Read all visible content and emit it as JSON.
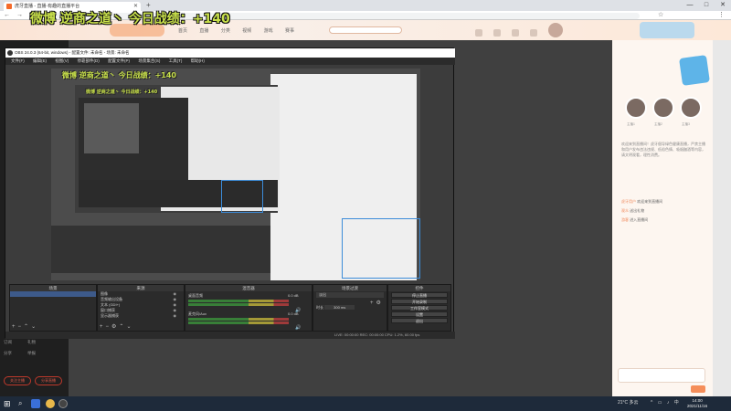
{
  "browser": {
    "tab_title": "虎牙直播 - 直播·有趣的直播平台",
    "new_tab": "+",
    "url": "www.huya.com",
    "window_controls": [
      "—",
      "□",
      "✕"
    ]
  },
  "overlay": {
    "title": "微博 逆商之道丶 今日战绩：+140",
    "title_small": "微博 逆商之道丶 今日战绩：+140"
  },
  "site": {
    "nav": [
      "首页",
      "直播",
      "分类",
      "视频",
      "游戏",
      "赛事"
    ]
  },
  "left_panel": {
    "labels": [
      "订阅",
      "礼物",
      "分享",
      "举报"
    ],
    "buttons": [
      "关注主播",
      "分享直播"
    ]
  },
  "obs": {
    "title": "OBS 24.0.3 (64-bit, windows) - 配置文件: 未命名 - 场景: 未命名",
    "menu": [
      "文件(F)",
      "编辑(E)",
      "视图(V)",
      "停靠部件(D)",
      "配置文件(P)",
      "场景集合(S)",
      "工具(T)",
      "帮助(H)"
    ],
    "scenes_header": "场景",
    "sources_header": "来源",
    "mixer_header": "混音器",
    "transitions_header": "场景过渡",
    "controls_header": "控件",
    "sources": [
      "图像",
      "音频输出设备",
      "文本 (GDI+)",
      "窗口捕获",
      "显示器捕获"
    ],
    "mixer_tracks": [
      {
        "name": "桌面音频",
        "level": "0.0 dB"
      },
      {
        "name": "麦克风/Aux",
        "level": "0.0 dB"
      }
    ],
    "transition_value": "淡出",
    "duration_label": "时长",
    "duration_value": "300 ms",
    "controls": [
      "停止直播",
      "开始录制",
      "工作室模式",
      "设置",
      "退出"
    ],
    "status": "LIVE: 00:00:00   REC: 00:00:00   CPU: 1.2%, 60.00 fps"
  },
  "right_panel": {
    "streamers": [
      "主播1",
      "主播2",
      "主播3"
    ],
    "notice": "欢迎来到直播间！虎牙倡导绿色健康直播，严禁主播和用户发布违法违规、低俗色情、吸烟酗酒等内容，请文明观看，理性消费。",
    "chat": [
      {
        "user": "虎牙用户",
        "text": "欢迎来到直播间"
      },
      {
        "user": "观众",
        "text": "送出礼物"
      },
      {
        "user": "游客",
        "text": "进入直播间"
      }
    ]
  },
  "taskbar": {
    "weather": "21°C 多云",
    "time": "14:00",
    "date": "2021/11/16"
  },
  "colors": {
    "accent": "#f58e5a",
    "overlay_text": "#c8e04a",
    "obs_bg": "#2b2b2b"
  }
}
